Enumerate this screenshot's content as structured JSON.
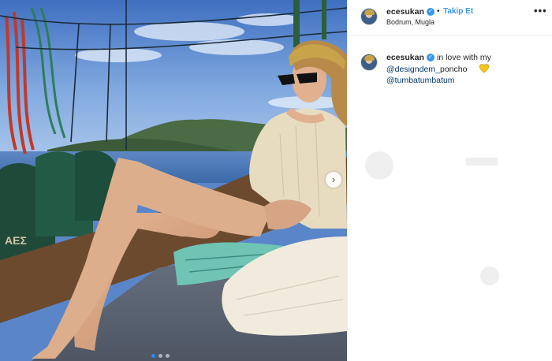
{
  "post": {
    "username": "ecesukan",
    "follow_label": "Takip Et",
    "location": "Bodrum, Mugla",
    "more_label": "•••",
    "separator": "•",
    "verified_mark": "✓",
    "next_arrow": "›",
    "caption": {
      "text": "in love with my",
      "mention_1": "@designdem_",
      "mention_1_suffix": "poncho",
      "mention_2": "@tumbatumbatum",
      "emoji": "yellow-heart-icon"
    },
    "carousel": {
      "slides": 3,
      "active_slide": 1
    },
    "photo": {
      "icons": [
        "rope-icon",
        "sail-bag-icon",
        "towel-icon"
      ],
      "boat_lettering": "ΑΕΣ"
    }
  },
  "colors": {
    "accent": "#3897f0",
    "mention": "#00376b",
    "heart": "#f5c518",
    "sky": "#5a86c9"
  }
}
